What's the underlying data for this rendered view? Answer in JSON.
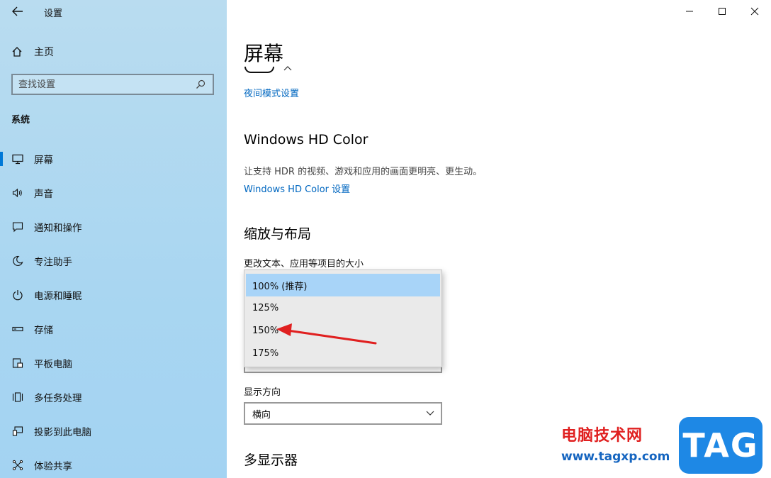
{
  "app": {
    "title": "设置",
    "back_icon": "arrow-left-icon"
  },
  "sidebar": {
    "home": "主页",
    "search_placeholder": "查找设置",
    "section": "系统",
    "items": [
      {
        "label": "屏幕",
        "icon": "monitor-icon",
        "active": true
      },
      {
        "label": "声音",
        "icon": "speaker-icon",
        "active": false
      },
      {
        "label": "通知和操作",
        "icon": "notification-icon",
        "active": false
      },
      {
        "label": "专注助手",
        "icon": "moon-icon",
        "active": false
      },
      {
        "label": "电源和睡眠",
        "icon": "power-icon",
        "active": false
      },
      {
        "label": "存储",
        "icon": "storage-icon",
        "active": false
      },
      {
        "label": "平板电脑",
        "icon": "tablet-icon",
        "active": false
      },
      {
        "label": "多任务处理",
        "icon": "multitask-icon",
        "active": false
      },
      {
        "label": "投影到此电脑",
        "icon": "project-icon",
        "active": false
      },
      {
        "label": "体验共享",
        "icon": "share-icon",
        "active": false
      }
    ]
  },
  "main": {
    "page_title": "屏幕",
    "night_link": "夜间模式设置",
    "hdr": {
      "title": "Windows HD Color",
      "desc": "让支持 HDR 的视频、游戏和应用的画面更明亮、更生动。",
      "link": "Windows HD Color 设置"
    },
    "scale": {
      "title": "缩放与布局",
      "label": "更改文本、应用等项目的大小",
      "options": [
        "100% (推荐)",
        "125%",
        "150%",
        "175%"
      ],
      "selected_index": 0
    },
    "orientation": {
      "label": "显示方向",
      "value": "横向"
    },
    "multi_display": "多显示器"
  },
  "watermark": {
    "text": "电脑技术网",
    "url": "www.tagxp.com",
    "badge": "TAG"
  },
  "colors": {
    "sidebar_bg": "#a9d6f1",
    "accent": "#0078d7",
    "link": "#0067c0",
    "selected": "#a8d4f8",
    "annotation_arrow": "#e02020"
  }
}
